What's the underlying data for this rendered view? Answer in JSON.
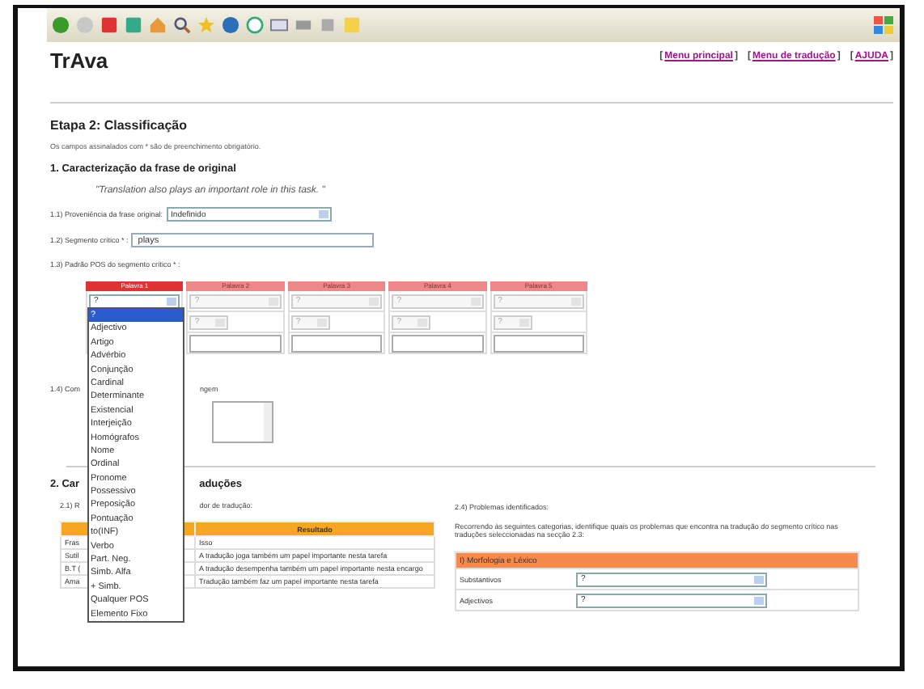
{
  "header": {
    "title": "TrAva",
    "links": [
      {
        "open": "[",
        "label": "Menu principal",
        "close": "]"
      },
      {
        "open": "[",
        "label": "Menu de tradução",
        "close": "]"
      },
      {
        "open": "[",
        "label": "AJUDA",
        "close": "]"
      }
    ]
  },
  "step_title": "Etapa 2: Classificação",
  "note": "Os campos assinalados com * são de preenchimento obrigatório.",
  "section_1": {
    "title": "1. Caracterização da frase de original",
    "quote": "\"Translation also plays an important role in this task. \"",
    "origin": {
      "label": "1.1) Proveniência da frase original:",
      "value": "Indefinido"
    },
    "segment": {
      "label": "1.2) Segmento crítico * :",
      "value": "plays"
    },
    "pos_label": "1.3) Padrão POS do segmento crítico * :",
    "pos_columns": [
      {
        "label": "Palavra 1",
        "selected": true,
        "disabled": false,
        "pos": "?"
      },
      {
        "label": "Palavra 2",
        "selected": false,
        "disabled": true,
        "pos": "?",
        "sub": "?"
      },
      {
        "label": "Palavra 3",
        "selected": false,
        "disabled": true,
        "pos": "?",
        "sub": "?"
      },
      {
        "label": "Palavra 4",
        "selected": false,
        "disabled": true,
        "pos": "?",
        "sub": "?"
      },
      {
        "label": "Palavra 5",
        "selected": false,
        "disabled": true,
        "pos": "?",
        "sub": "?"
      }
    ],
    "pos_options": [
      {
        "label": "?",
        "selected": true
      },
      {
        "label": "Adjectivo",
        "selected": false
      },
      {
        "label": "Artigo",
        "selected": false
      },
      {
        "label": "Advérbio",
        "selected": false
      },
      {
        "label": "Conjunção",
        "selected": false
      },
      {
        "label": "Cardinal",
        "selected": false
      },
      {
        "label": "Determinante",
        "selected": false
      },
      {
        "label": "Existencial",
        "selected": false
      },
      {
        "label": "Interjeição",
        "selected": false
      },
      {
        "label": "Homógrafos",
        "selected": false
      },
      {
        "label": "Nome",
        "selected": false
      },
      {
        "label": "Ordinal",
        "selected": false
      },
      {
        "label": "Pronome",
        "selected": false
      },
      {
        "label": "Possessivo",
        "selected": false
      },
      {
        "label": "Preposição",
        "selected": false
      },
      {
        "label": "Pontuação",
        "selected": false
      },
      {
        "label": "to(INF)",
        "selected": false
      },
      {
        "label": "Verbo",
        "selected": false
      },
      {
        "label": "Part. Neg.",
        "selected": false
      },
      {
        "label": "Simb. Alfa",
        "selected": false
      },
      {
        "label": "+ Simb.",
        "selected": false
      },
      {
        "label": "Qualquer POS",
        "selected": false
      },
      {
        "label": "Elemento Fixo",
        "selected": false
      }
    ],
    "comment_label_start": "1.4) Com",
    "comment_label_end": "ngem"
  },
  "section_2": {
    "title_start": "2. Car",
    "title_end": "aduções",
    "intro_start": "2.1) R",
    "intro_end": "dor de tradução:",
    "result_header": "Resultado",
    "rows": [
      {
        "cell_1": "Fras",
        "result": "Isso"
      },
      {
        "cell_1": "Sutil",
        "result": "A tradução joga também um papel importante nesta tarefa"
      },
      {
        "cell_1": "B.T (",
        "result": "A tradução desempenha também um papel importante nesta encargo"
      },
      {
        "cell_1": "Ama",
        "result": "Tradução também faz um papel importante nesta tarefa"
      }
    ],
    "problems": {
      "label": "2.4) Problemas identificados:",
      "text": "Recorrendo às seguintes categorias, identifique quais os problemas que encontra na tradução do segmento crítico nas traduções seleccionadas na secção 2.3:",
      "category": "I) Morfologia e Léxico",
      "rows": [
        {
          "label": "Substantivos",
          "value": "?"
        },
        {
          "label": "Adjectivos",
          "value": "?"
        }
      ]
    }
  }
}
